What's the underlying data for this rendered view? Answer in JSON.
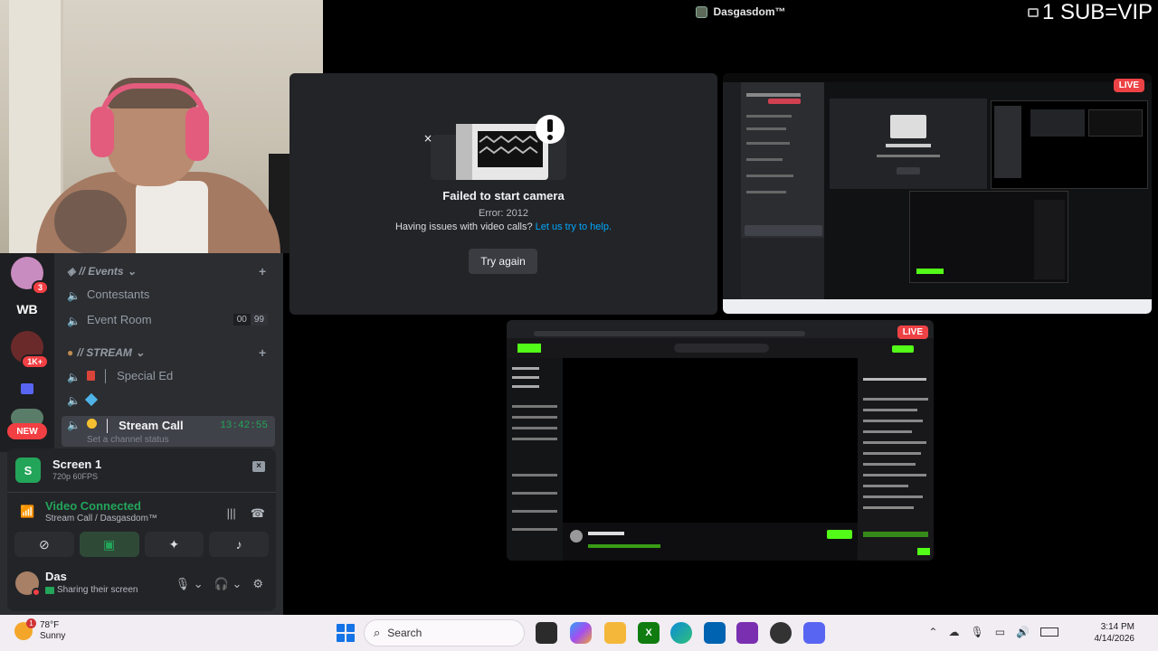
{
  "window": {
    "title": "Dasgasdom™",
    "overlay_text": "1 SUB=VIP"
  },
  "sidebar": {
    "servers": [
      {
        "label": "",
        "badge": "3"
      },
      {
        "label": "WB"
      },
      {
        "label": "",
        "badge": "1K+"
      },
      {
        "label": ""
      },
      {
        "label": "",
        "badge": "NEW"
      }
    ],
    "categories": [
      {
        "label": "// Events",
        "channels": [
          {
            "label": "Contestants"
          },
          {
            "label": "Event Room",
            "limit_a": "00",
            "limit_b": "99"
          }
        ]
      },
      {
        "label": "// STREAM",
        "channels": [
          {
            "label": "Special Ed",
            "prefix": "│"
          },
          {
            "label": ""
          },
          {
            "label": "Stream Call",
            "prefix": "│",
            "timer": "13:42:55",
            "status": "Set a channel status"
          }
        ]
      }
    ]
  },
  "stream_panel": {
    "screen_title": "Screen 1",
    "screen_sub": "720p 60FPS",
    "voice_status": "Video Connected",
    "voice_location": "Stream Call / Dasgasdom™",
    "user_name": "Das",
    "user_status": "Sharing their screen"
  },
  "camera_tile": {
    "title": "Failed to start camera",
    "error": "Error: 2012",
    "help_text": "Having issues with video calls?",
    "help_link": "Let us try to help.",
    "button": "Try again"
  },
  "streams": [
    {
      "live_label": "LIVE"
    },
    {
      "live_label": "LIVE"
    }
  ],
  "taskbar": {
    "temperature": "78°F",
    "condition": "Sunny",
    "weather_badge": "1",
    "search_placeholder": "Search",
    "time": "3:14 PM",
    "date": "4/14/2026"
  },
  "colors": {
    "accent_green": "#23a55a",
    "live_red": "#ed4245",
    "link_blue": "#00a8fc"
  }
}
